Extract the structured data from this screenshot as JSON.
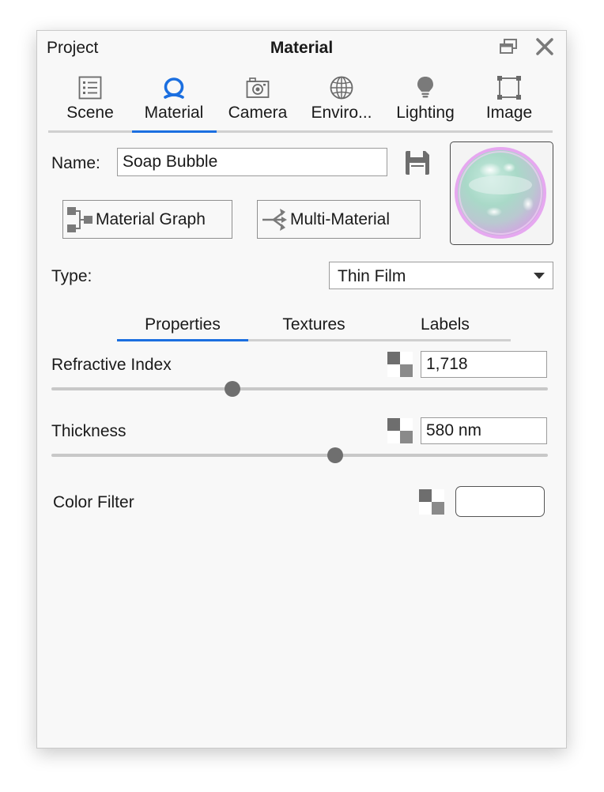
{
  "window": {
    "left_title": "Project",
    "title": "Material"
  },
  "tabs": [
    {
      "label": "Scene",
      "icon": "list-icon"
    },
    {
      "label": "Material",
      "icon": "material-sphere-icon",
      "active": true
    },
    {
      "label": "Camera",
      "icon": "camera-icon"
    },
    {
      "label": "Enviro...",
      "icon": "globe-icon"
    },
    {
      "label": "Lighting",
      "icon": "lightbulb-icon"
    },
    {
      "label": "Image",
      "icon": "image-frame-icon"
    }
  ],
  "name_row": {
    "label": "Name:",
    "value": "Soap Bubble"
  },
  "buttons": {
    "material_graph": "Material Graph",
    "multi_material": "Multi-Material"
  },
  "type_row": {
    "label": "Type:",
    "selected": "Thin Film"
  },
  "subtabs": [
    {
      "label": "Properties",
      "active": true
    },
    {
      "label": "Textures"
    },
    {
      "label": "Labels"
    }
  ],
  "properties": {
    "refractive_index": {
      "label": "Refractive Index",
      "value": "1,718",
      "slider": 0.365
    },
    "thickness": {
      "label": "Thickness",
      "value": "580 nm",
      "slider": 0.572
    },
    "color_filter": {
      "label": "Color Filter",
      "color": "#ffffff"
    }
  },
  "colors": {
    "accent": "#1b6fe0",
    "panel_bg": "#f8f8f8"
  }
}
